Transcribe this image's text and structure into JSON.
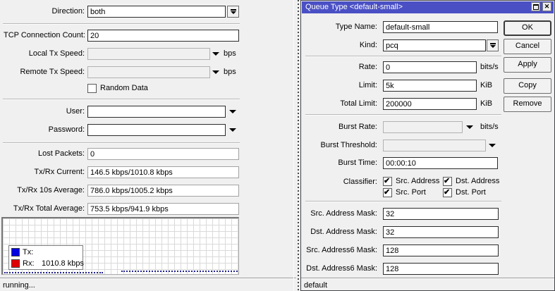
{
  "colors": {
    "titlebar": "#4a50c4",
    "tx_series": "#0000e0",
    "rx_series": "#e00000"
  },
  "left_panel": {
    "direction": {
      "label": "Direction:",
      "value": "both"
    },
    "tcp_connection_count": {
      "label": "TCP Connection Count:",
      "value": "20"
    },
    "local_tx_speed": {
      "label": "Local Tx Speed:",
      "value": "",
      "unit": "bps"
    },
    "remote_tx_speed": {
      "label": "Remote Tx Speed:",
      "value": "",
      "unit": "bps"
    },
    "random_data": {
      "label": "Random Data",
      "checked": false
    },
    "user": {
      "label": "User:",
      "value": ""
    },
    "password": {
      "label": "Password:",
      "value": ""
    },
    "lost_packets": {
      "label": "Lost Packets:",
      "value": "0"
    },
    "txrx_current": {
      "label": "Tx/Rx Current:",
      "value": "146.5 kbps/1010.8 kbps"
    },
    "txrx_10s_average": {
      "label": "Tx/Rx 10s Average:",
      "value": "786.0 kbps/1005.2 kbps"
    },
    "txrx_total_average": {
      "label": "Tx/Rx Total Average:",
      "value": "753.5 kbps/941.9 kbps"
    },
    "graph_legend": {
      "tx_label": "Tx:",
      "tx_value": "",
      "rx_label": "Rx:",
      "rx_value": "1010.8 kbps"
    },
    "status": "running..."
  },
  "dialog": {
    "title": "Queue Type <default-small>",
    "type_name": {
      "label": "Type Name:",
      "value": "default-small"
    },
    "kind": {
      "label": "Kind:",
      "value": "pcq"
    },
    "rate": {
      "label": "Rate:",
      "value": "0",
      "unit": "bits/s"
    },
    "limit": {
      "label": "Limit:",
      "value": "5k",
      "unit": "KiB"
    },
    "total_limit": {
      "label": "Total Limit:",
      "value": "200000",
      "unit": "KiB"
    },
    "burst_rate": {
      "label": "Burst Rate:",
      "value": "",
      "unit": "bits/s"
    },
    "burst_threshold": {
      "label": "Burst Threshold:",
      "value": ""
    },
    "burst_time": {
      "label": "Burst Time:",
      "value": "00:00:10"
    },
    "classifier": {
      "label": "Classifier:",
      "options": [
        {
          "label": "Src. Address",
          "checked": true
        },
        {
          "label": "Dst. Address",
          "checked": true
        },
        {
          "label": "Src. Port",
          "checked": true
        },
        {
          "label": "Dst. Port",
          "checked": true
        }
      ]
    },
    "src_address_mask": {
      "label": "Src. Address Mask:",
      "value": "32"
    },
    "dst_address_mask": {
      "label": "Dst. Address Mask:",
      "value": "32"
    },
    "src_address6_mask": {
      "label": "Src. Address6 Mask:",
      "value": "128"
    },
    "dst_address6_mask": {
      "label": "Dst. Address6 Mask:",
      "value": "128"
    },
    "buttons": {
      "ok": "OK",
      "cancel": "Cancel",
      "apply": "Apply",
      "copy": "Copy",
      "remove": "Remove"
    },
    "status": "default"
  }
}
